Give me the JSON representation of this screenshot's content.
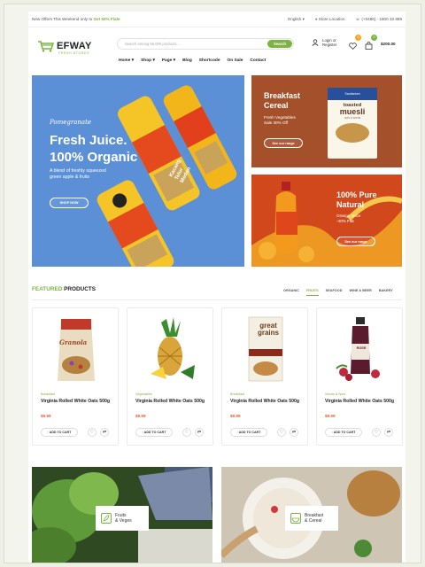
{
  "topbar": {
    "offer_prefix": "New Offers This Weekend only to",
    "offer_highlight": "Get 50% Flate",
    "language": "English",
    "store_location": "Store Location",
    "phone": "(+0486) - 1800 33 889"
  },
  "header": {
    "logo_text": "EFWAY",
    "logo_sub": "FRESH STORES",
    "search_placeholder": "Search among 56,000 products...",
    "search_button": "Search",
    "login_line1": "Login or",
    "login_line2": "Register",
    "wishlist_count": "0",
    "cart_count": "0",
    "cart_total": "$200.00"
  },
  "nav": [
    "Home",
    "Shop",
    "Page",
    "Blog",
    "Shortcode",
    "On Sale",
    "Contact"
  ],
  "banners": {
    "main": {
      "script": "Pomegranate",
      "title1": "Fresh Juice.",
      "title2": "100% Organic",
      "desc1": "A blend of freshly squeezed",
      "desc2": "green apple & fruits",
      "button": "SHOP NOW",
      "pack1_a": "Kacang",
      "pack1_b": "Telur",
      "pack1_c": "Medan"
    },
    "cereal": {
      "title1": "Breakfast",
      "title2": "Cereal",
      "desc1": "Fresh Vegetables",
      "desc2": "Sale 30% Off",
      "button": "See our range",
      "box_brand": "Sanitarium",
      "box_t1": "toasted",
      "box_t2": "muesli",
      "box_t3": "nuts & seeds"
    },
    "natural": {
      "title1": "100% Pure",
      "title2": "Natural",
      "desc1": "Orange Juice",
      "desc2": "-40% Flat",
      "button": "See our range"
    }
  },
  "featured": {
    "title_green": "FEATURED",
    "title_dark": "PRODUCTS",
    "tabs": [
      "ORGANIC",
      "FRUITS",
      "SEAFOOD",
      "WINE & BEER",
      "BAKERY"
    ],
    "products": [
      {
        "category": "Breakfast",
        "name": "Virginia Rolled White Oats 500g",
        "price": "$9.99",
        "add": "ADD TO CART",
        "pack_text": "Granola"
      },
      {
        "category": "Vegetables",
        "name": "Virginia Rolled White Oats 500g",
        "price": "$9.99",
        "add": "ADD TO CART"
      },
      {
        "category": "Breakfast",
        "name": "Virginia Rolled White Oats 500g",
        "price": "$9.99",
        "add": "ADD TO CART",
        "pack_text1": "great",
        "pack_text2": "grains"
      },
      {
        "category": "Seeds & Nuts",
        "name": "Virginia Rolled White Oats 500g",
        "price": "$9.99",
        "add": "ADD TO CART",
        "pack_text": "ROSE"
      }
    ]
  },
  "categories": [
    {
      "line1": "Fruits",
      "line2": "& Veges"
    },
    {
      "line1": "Breakfast",
      "line2": "& Cereal"
    }
  ],
  "colors": {
    "accent": "#7cb342",
    "price": "#e65c27",
    "cart_badge": "#f5a623"
  }
}
